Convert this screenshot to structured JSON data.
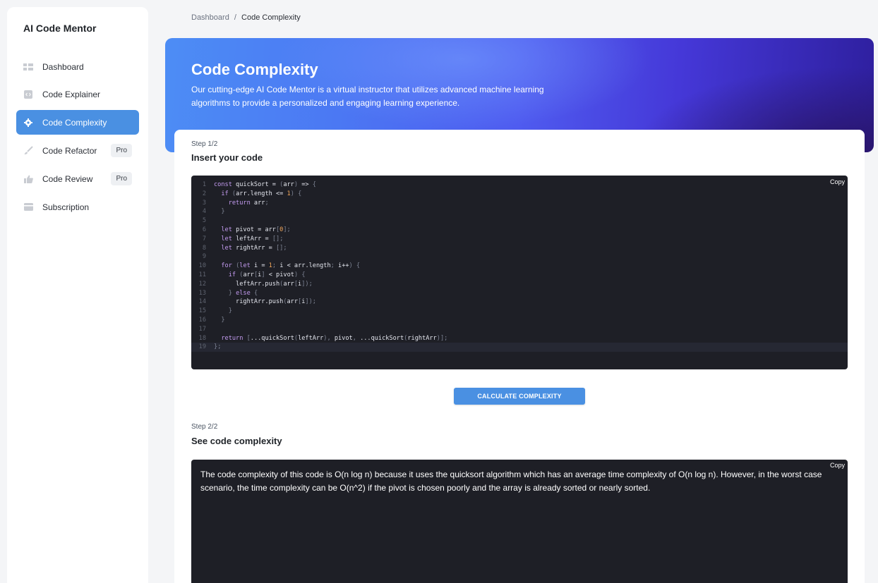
{
  "sidebar": {
    "brand": "AI Code Mentor",
    "items": [
      {
        "label": "Dashboard",
        "icon": "dashboard-icon",
        "active": false,
        "badge": ""
      },
      {
        "label": "Code Explainer",
        "icon": "code-icon",
        "active": false,
        "badge": ""
      },
      {
        "label": "Code Complexity",
        "icon": "gear-icon",
        "active": true,
        "badge": ""
      },
      {
        "label": "Code Refactor",
        "icon": "brush-icon",
        "active": false,
        "badge": "Pro"
      },
      {
        "label": "Code Review",
        "icon": "thumbs-up-icon",
        "active": false,
        "badge": "Pro"
      },
      {
        "label": "Subscription",
        "icon": "card-icon",
        "active": false,
        "badge": ""
      }
    ]
  },
  "breadcrumb": {
    "root": "Dashboard",
    "separator": "/",
    "current": "Code Complexity"
  },
  "hero": {
    "title": "Code Complexity",
    "description": "Our cutting-edge AI Code Mentor is a virtual instructor that utilizes advanced machine learning algorithms to provide a personalized and engaging learning experience."
  },
  "step1": {
    "label": "Step 1/2",
    "title": "Insert your code",
    "copy_label": "Copy",
    "code_lines": [
      "const quickSort = (arr) => {",
      "  if (arr.length <= 1) {",
      "    return arr;",
      "  }",
      "",
      "  let pivot = arr[0];",
      "  let leftArr = [];",
      "  let rightArr = [];",
      "",
      "  for (let i = 1; i < arr.length; i++) {",
      "    if (arr[i] < pivot) {",
      "      leftArr.push(arr[i]);",
      "    } else {",
      "      rightArr.push(arr[i]);",
      "    }",
      "  }",
      "",
      "  return [...quickSort(leftArr), pivot, ...quickSort(rightArr)];",
      "};"
    ]
  },
  "calculate_button": "CALCULATE COMPLEXITY",
  "step2": {
    "label": "Step 2/2",
    "title": "See code complexity",
    "copy_label": "Copy",
    "result": "The code complexity of this code is O(n log n) because it uses the quicksort algorithm which has an average time complexity of O(n log n). However, in the worst case scenario, the time complexity can be O(n^2) if the pivot is chosen poorly and the array is already sorted or nearly sorted."
  },
  "colors": {
    "accent": "#4a90e2",
    "code_bg": "#1e1f26"
  }
}
